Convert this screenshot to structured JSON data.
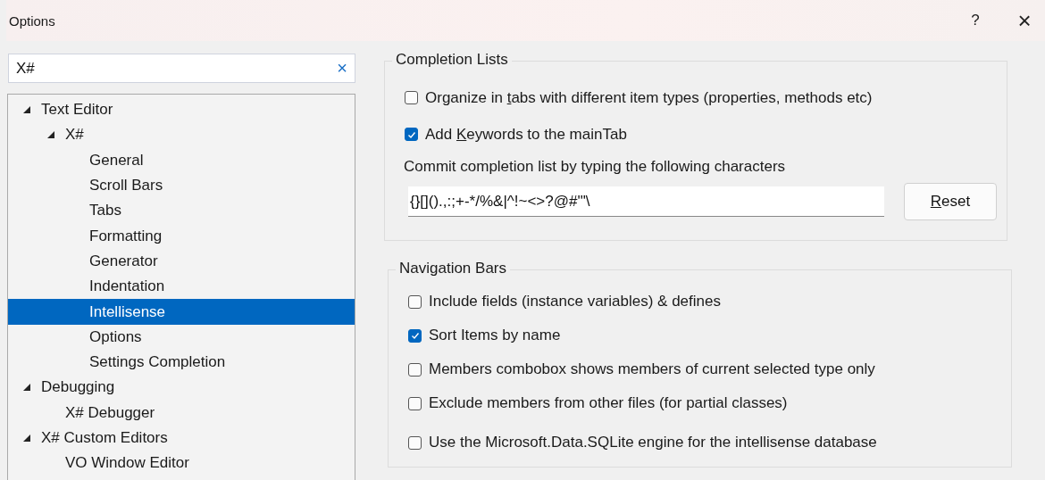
{
  "window": {
    "title": "Options",
    "help": "?",
    "close": "×"
  },
  "search": {
    "value": "X#",
    "clear": "×"
  },
  "tree": [
    {
      "label": "Text Editor",
      "expanded": true,
      "selected": false,
      "children": [
        {
          "label": "X#",
          "expanded": true,
          "selected": false,
          "children": [
            {
              "label": "General",
              "selected": false
            },
            {
              "label": "Scroll Bars",
              "selected": false
            },
            {
              "label": "Tabs",
              "selected": false
            },
            {
              "label": "Formatting",
              "selected": false
            },
            {
              "label": "Generator",
              "selected": false
            },
            {
              "label": "Indentation",
              "selected": false
            },
            {
              "label": "Intellisense",
              "selected": true
            },
            {
              "label": "Options",
              "selected": false
            },
            {
              "label": "Settings Completion",
              "selected": false
            }
          ]
        }
      ]
    },
    {
      "label": "Debugging",
      "expanded": true,
      "selected": false,
      "children": [
        {
          "label": "X# Debugger",
          "selected": false
        }
      ]
    },
    {
      "label": "X# Custom Editors",
      "expanded": true,
      "selected": false,
      "children": [
        {
          "label": "VO Window Editor",
          "selected": false
        }
      ]
    }
  ],
  "completion_lists": {
    "title": "Completion Lists",
    "options": [
      {
        "label": "Organize in ",
        "access_key": "t",
        "label_end": "abs with different item types (properties, methods etc)",
        "checked": false
      },
      {
        "label": "Add ",
        "access_key": "K",
        "label_end": "eywords to the mainTab",
        "checked": true
      }
    ],
    "commit_label": "Commit completion list by typing the following characters",
    "commit_value": "{}[]().,:;+-*/%&|^!~<>?@#'\"\\",
    "reset_button": {
      "access_key": "R",
      "label_end": "eset"
    }
  },
  "navigation_bars": {
    "title": "Navigation Bars",
    "options": [
      {
        "label": "Include fields (instance variables) & defines",
        "checked": false
      },
      {
        "label": "Sort Items by name",
        "checked": true
      },
      {
        "label": "Members combobox shows members of current selected type only",
        "checked": false
      },
      {
        "label": "Exclude members from other files (for partial classes)",
        "checked": false
      },
      {
        "label": "Use the Microsoft.Data.SQLite engine for the intellisense database",
        "checked": false
      }
    ]
  }
}
